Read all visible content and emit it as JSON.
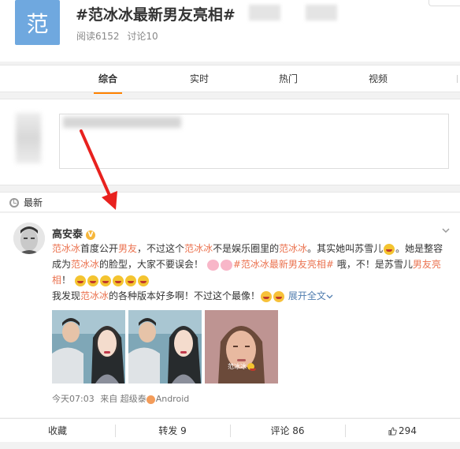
{
  "topic": {
    "avatar_char": "范",
    "title": "#范冰冰最新男友亮相#",
    "reads": "阅读6152",
    "discussions": "讨论10"
  },
  "tabs": [
    {
      "label": "综合",
      "active": true
    },
    {
      "label": "实时",
      "active": false
    },
    {
      "label": "热门",
      "active": false
    },
    {
      "label": "视频",
      "active": false
    }
  ],
  "latest": {
    "label": "最新"
  },
  "post": {
    "author": "高安泰",
    "body": {
      "seg1": "范冰冰",
      "seg2": "首度公开",
      "seg3": "男友",
      "seg4": "，不过这个",
      "seg5": "范冰冰",
      "seg6": "不是娱乐圈里的",
      "seg7": "范冰冰",
      "seg8": "。其实她叫苏雪儿",
      "seg9": "。她是整容成为",
      "seg10": "范冰冰",
      "seg11": "的脸型，大家不要误会！",
      "seg12": "#范冰冰最新男友亮相#",
      "seg13": " 哦，不！是苏雪儿",
      "seg14": "男友亮相",
      "seg15": "！",
      "line3a": "我发现",
      "line3b": "范冰冰",
      "line3c": "的各种版本好多啊！不过这个最像！",
      "expand": "展开全文"
    },
    "photo_caption": "范冰冰",
    "meta": {
      "time": "今天07:03",
      "source_prefix": "来自",
      "source_name": "超级泰",
      "device": "Android"
    }
  },
  "actions": {
    "collect": "收藏",
    "repost": "转发 9",
    "comment": "评论 86",
    "like": "294"
  },
  "colors": {
    "accent": "#ff8200",
    "keyword_red": "#eb7350",
    "link_blue": "#507daf",
    "topic_avatar": "#6fa8df"
  }
}
